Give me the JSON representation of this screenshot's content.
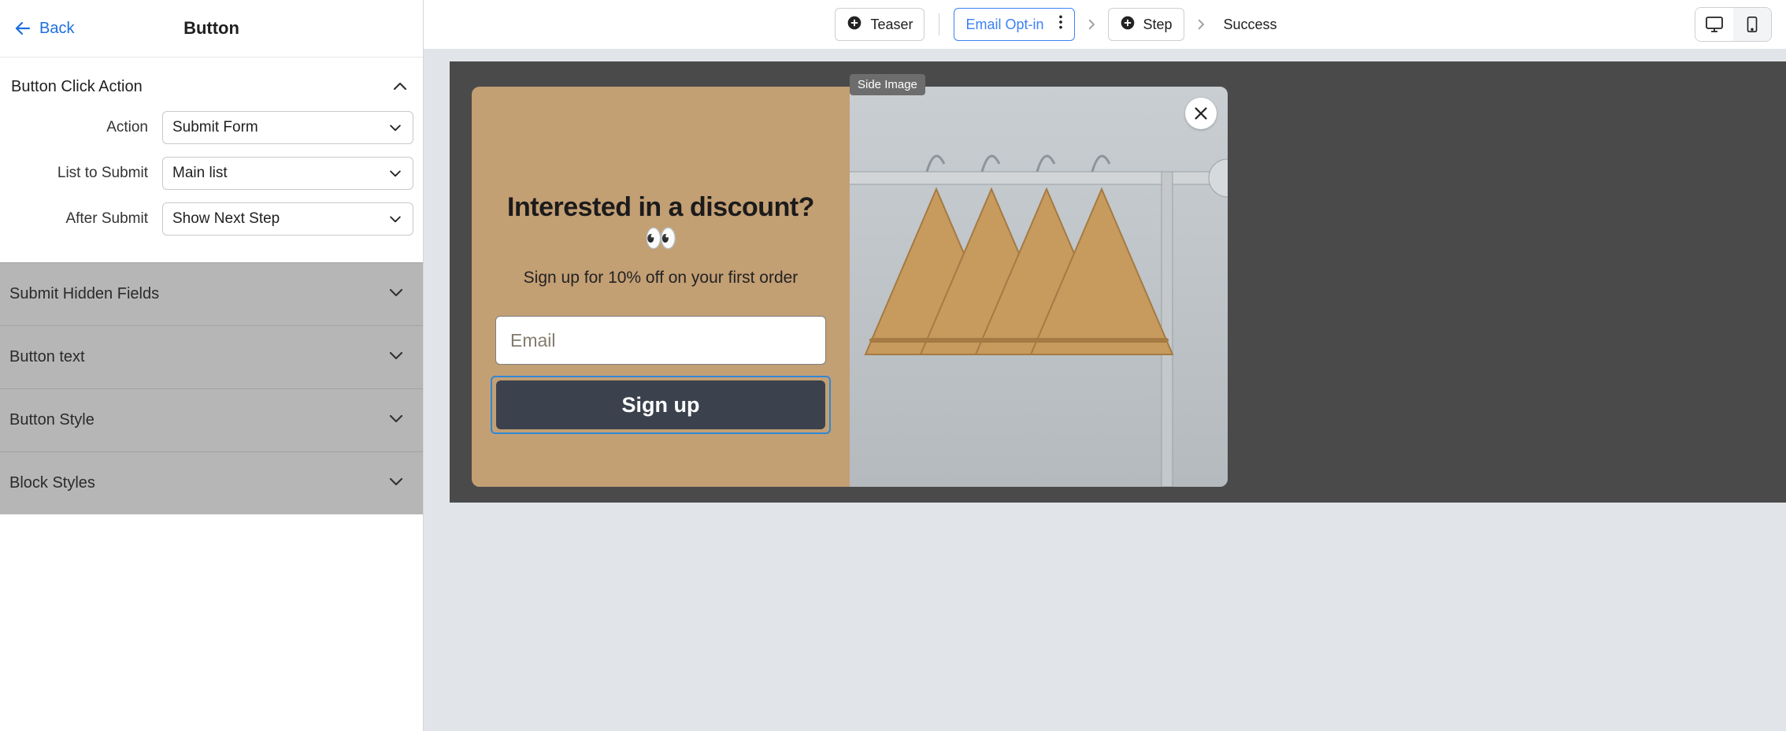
{
  "header": {
    "back_label": "Back",
    "panel_title": "Button"
  },
  "panel": {
    "open_section_title": "Button Click Action",
    "fields": {
      "action_label": "Action",
      "action_value": "Submit Form",
      "list_label": "List to Submit",
      "list_value": "Main list",
      "after_label": "After Submit",
      "after_value": "Show Next Step"
    },
    "closed_sections": {
      "hidden_fields": "Submit Hidden Fields",
      "button_text": "Button text",
      "button_style": "Button Style",
      "block_styles": "Block Styles"
    }
  },
  "steps": {
    "teaser": "Teaser",
    "email_optin": "Email Opt-in",
    "step": "Step",
    "success": "Success"
  },
  "preview": {
    "side_image_tag": "Side Image",
    "headline": "Interested in a discount? 👀",
    "subhead": "Sign up for 10% off on your first order",
    "email_placeholder": "Email",
    "signup_button": "Sign up"
  },
  "colors": {
    "popup_bg": "#c39f74",
    "popup_button_bg": "#3b424d",
    "accent_blue": "#1f6fe0"
  }
}
